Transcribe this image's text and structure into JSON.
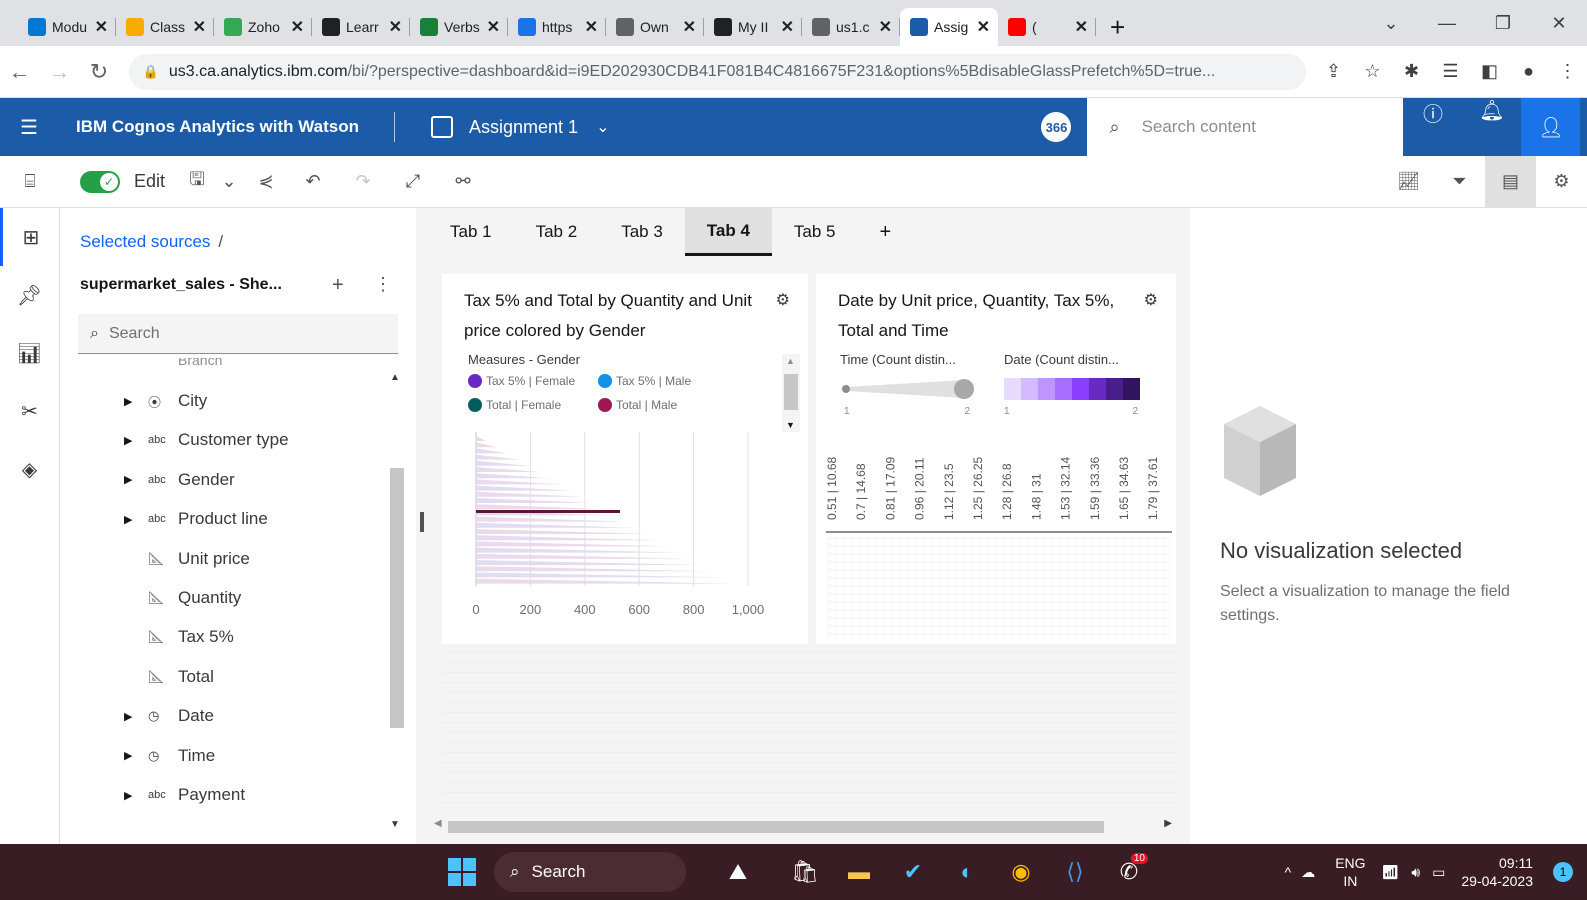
{
  "browser": {
    "tabs": [
      {
        "label": "Modu",
        "icon": "edge-icon",
        "color": "#0078d4"
      },
      {
        "label": "Class",
        "icon": "classroom-icon",
        "color": "#f9ab00"
      },
      {
        "label": "Zoho",
        "icon": "zoho-icon",
        "color": "#34a853"
      },
      {
        "label": "Learr",
        "icon": "learn-icon",
        "color": "#202124"
      },
      {
        "label": "Verbs",
        "icon": "verbs-icon",
        "color": "#188038"
      },
      {
        "label": "https",
        "icon": "page-icon",
        "color": "#1a73e8"
      },
      {
        "label": "Own",
        "icon": "globe-icon",
        "color": "#5f6368"
      },
      {
        "label": "My II",
        "icon": "myii-icon",
        "color": "#202124"
      },
      {
        "label": "us1.c",
        "icon": "globe-icon",
        "color": "#5f6368"
      },
      {
        "label": "Assig",
        "icon": "cognos-icon",
        "color": "#1c5ba8",
        "active": true
      },
      {
        "label": "(",
        "icon": "youtube-icon",
        "color": "#ff0000"
      }
    ],
    "url_host": "us3.ca.analytics.ibm.com",
    "url_rest": "/bi/?perspective=dashboard&id=i9ED202930CDB41F081B4C4816675F231&options%5BdisableGlassPrefetch%5D=true..."
  },
  "app": {
    "title": "IBM Cognos Analytics with Watson",
    "dashboard_name": "Assignment 1",
    "badge": "366",
    "search_placeholder": "Search content"
  },
  "toolbar": {
    "edit_label": "Edit"
  },
  "sources": {
    "breadcrumb": "Selected sources",
    "source_name": "supermarket_sales - She...",
    "search_placeholder": "Search",
    "partial_item": "Branch",
    "items": [
      {
        "label": "City",
        "type": "location",
        "caret": true
      },
      {
        "label": "Customer type",
        "type": "abc",
        "caret": true
      },
      {
        "label": "Gender",
        "type": "abc",
        "caret": true
      },
      {
        "label": "Product line",
        "type": "abc",
        "caret": true
      },
      {
        "label": "Unit price",
        "type": "measure",
        "caret": false
      },
      {
        "label": "Quantity",
        "type": "measure",
        "caret": false
      },
      {
        "label": "Tax 5%",
        "type": "measure",
        "caret": false
      },
      {
        "label": "Total",
        "type": "measure",
        "caret": false
      },
      {
        "label": "Date",
        "type": "time",
        "caret": true
      },
      {
        "label": "Time",
        "type": "time",
        "caret": true
      },
      {
        "label": "Payment",
        "type": "abc",
        "caret": true
      }
    ]
  },
  "tabs": [
    "Tab 1",
    "Tab 2",
    "Tab 3",
    "Tab 4",
    "Tab 5"
  ],
  "active_tab": "Tab 4",
  "add_tab": "+",
  "viz1": {
    "title": "Tax 5% and Total by Quantity and Unit price colored by Gender",
    "legend_title": "Measures - Gender",
    "legend": [
      {
        "label": "Tax 5% | Female",
        "color": "#6929c4"
      },
      {
        "label": "Tax 5% | Male",
        "color": "#1192e8"
      },
      {
        "label": "Total | Female",
        "color": "#005d5d"
      },
      {
        "label": "Total | Male",
        "color": "#9f1853"
      }
    ]
  },
  "viz2": {
    "title": "Date by Unit price, Quantity, Tax 5%, Total and Time",
    "legend_time": "Time (Count distin...",
    "legend_date": "Date (Count distin...",
    "time_min": "1",
    "time_max": "2",
    "date_min": "1",
    "date_max": "2",
    "date_colors": [
      "#e8daff",
      "#d4bbff",
      "#be95ff",
      "#a56eff",
      "#8a3ffc",
      "#6929c4",
      "#491d8b",
      "#31135e"
    ]
  },
  "chart_data": [
    {
      "type": "bar",
      "title": "Tax 5% and Total by Quantity and Unit price colored by Gender",
      "x_ticks": [
        "0",
        "200",
        "400",
        "600",
        "800",
        "1,000"
      ],
      "xlim": [
        0,
        1000
      ],
      "series": [
        {
          "name": "Tax 5% | Female",
          "color": "#6929c4"
        },
        {
          "name": "Tax 5% | Male",
          "color": "#1192e8"
        },
        {
          "name": "Total | Female",
          "color": "#005d5d"
        },
        {
          "name": "Total | Male",
          "color": "#9f1853"
        }
      ]
    },
    {
      "type": "heatmap",
      "title": "Date by Unit price, Quantity, Tax 5%, Total and Time",
      "categories": [
        "0.51 | 10.68",
        "0.7 | 14.68",
        "0.81 | 17.09",
        "0.96 | 20.11",
        "1.12 | 23.5",
        "1.25 | 26.25",
        "1.28 | 26.8",
        "1.48 | 31",
        "1.53 | 32.14",
        "1.59 | 33.36",
        "1.65 | 34.63",
        "1.79 | 37.61"
      ]
    }
  ],
  "properties": {
    "empty_title": "No visualization selected",
    "empty_text": "Select a visualization to manage the field settings."
  },
  "taskbar": {
    "search": "Search",
    "lang_top": "ENG",
    "lang_bottom": "IN",
    "time": "09:11",
    "date": "29-04-2023",
    "notifications": "1",
    "whatsapp_badge": "10"
  }
}
